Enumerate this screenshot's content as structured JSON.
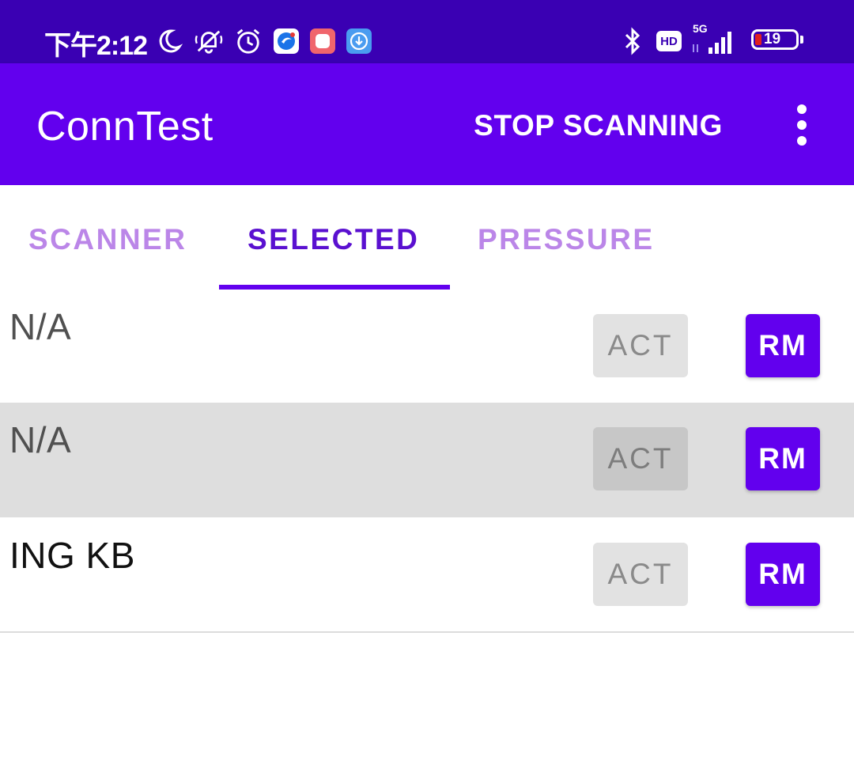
{
  "status_bar": {
    "time": "下午2:12",
    "left_icons": [
      "moon-icon",
      "bell-off-icon",
      "alarm-icon",
      "browser-app-icon",
      "recorder-app-icon",
      "download-app-icon"
    ],
    "network": "5G",
    "hd_badge": "HD",
    "battery": "19",
    "colors": {
      "background": "#3a00b3",
      "battery_low": "#e0201e"
    }
  },
  "app_bar": {
    "title": "ConnTest",
    "action": "STOP SCANNING",
    "overflow_icon": "more-vert-icon",
    "color": "#6200ee"
  },
  "tabs": [
    {
      "label": "SCANNER",
      "active": false
    },
    {
      "label": "SELECTED",
      "active": true
    },
    {
      "label": "PRESSURE",
      "active": false
    }
  ],
  "devices": [
    {
      "name": "N/A",
      "act_label": "ACT",
      "rm_label": "RM"
    },
    {
      "name": "N/A",
      "act_label": "ACT",
      "rm_label": "RM"
    },
    {
      "name": "ING KB",
      "act_label": "ACT",
      "rm_label": "RM"
    }
  ]
}
